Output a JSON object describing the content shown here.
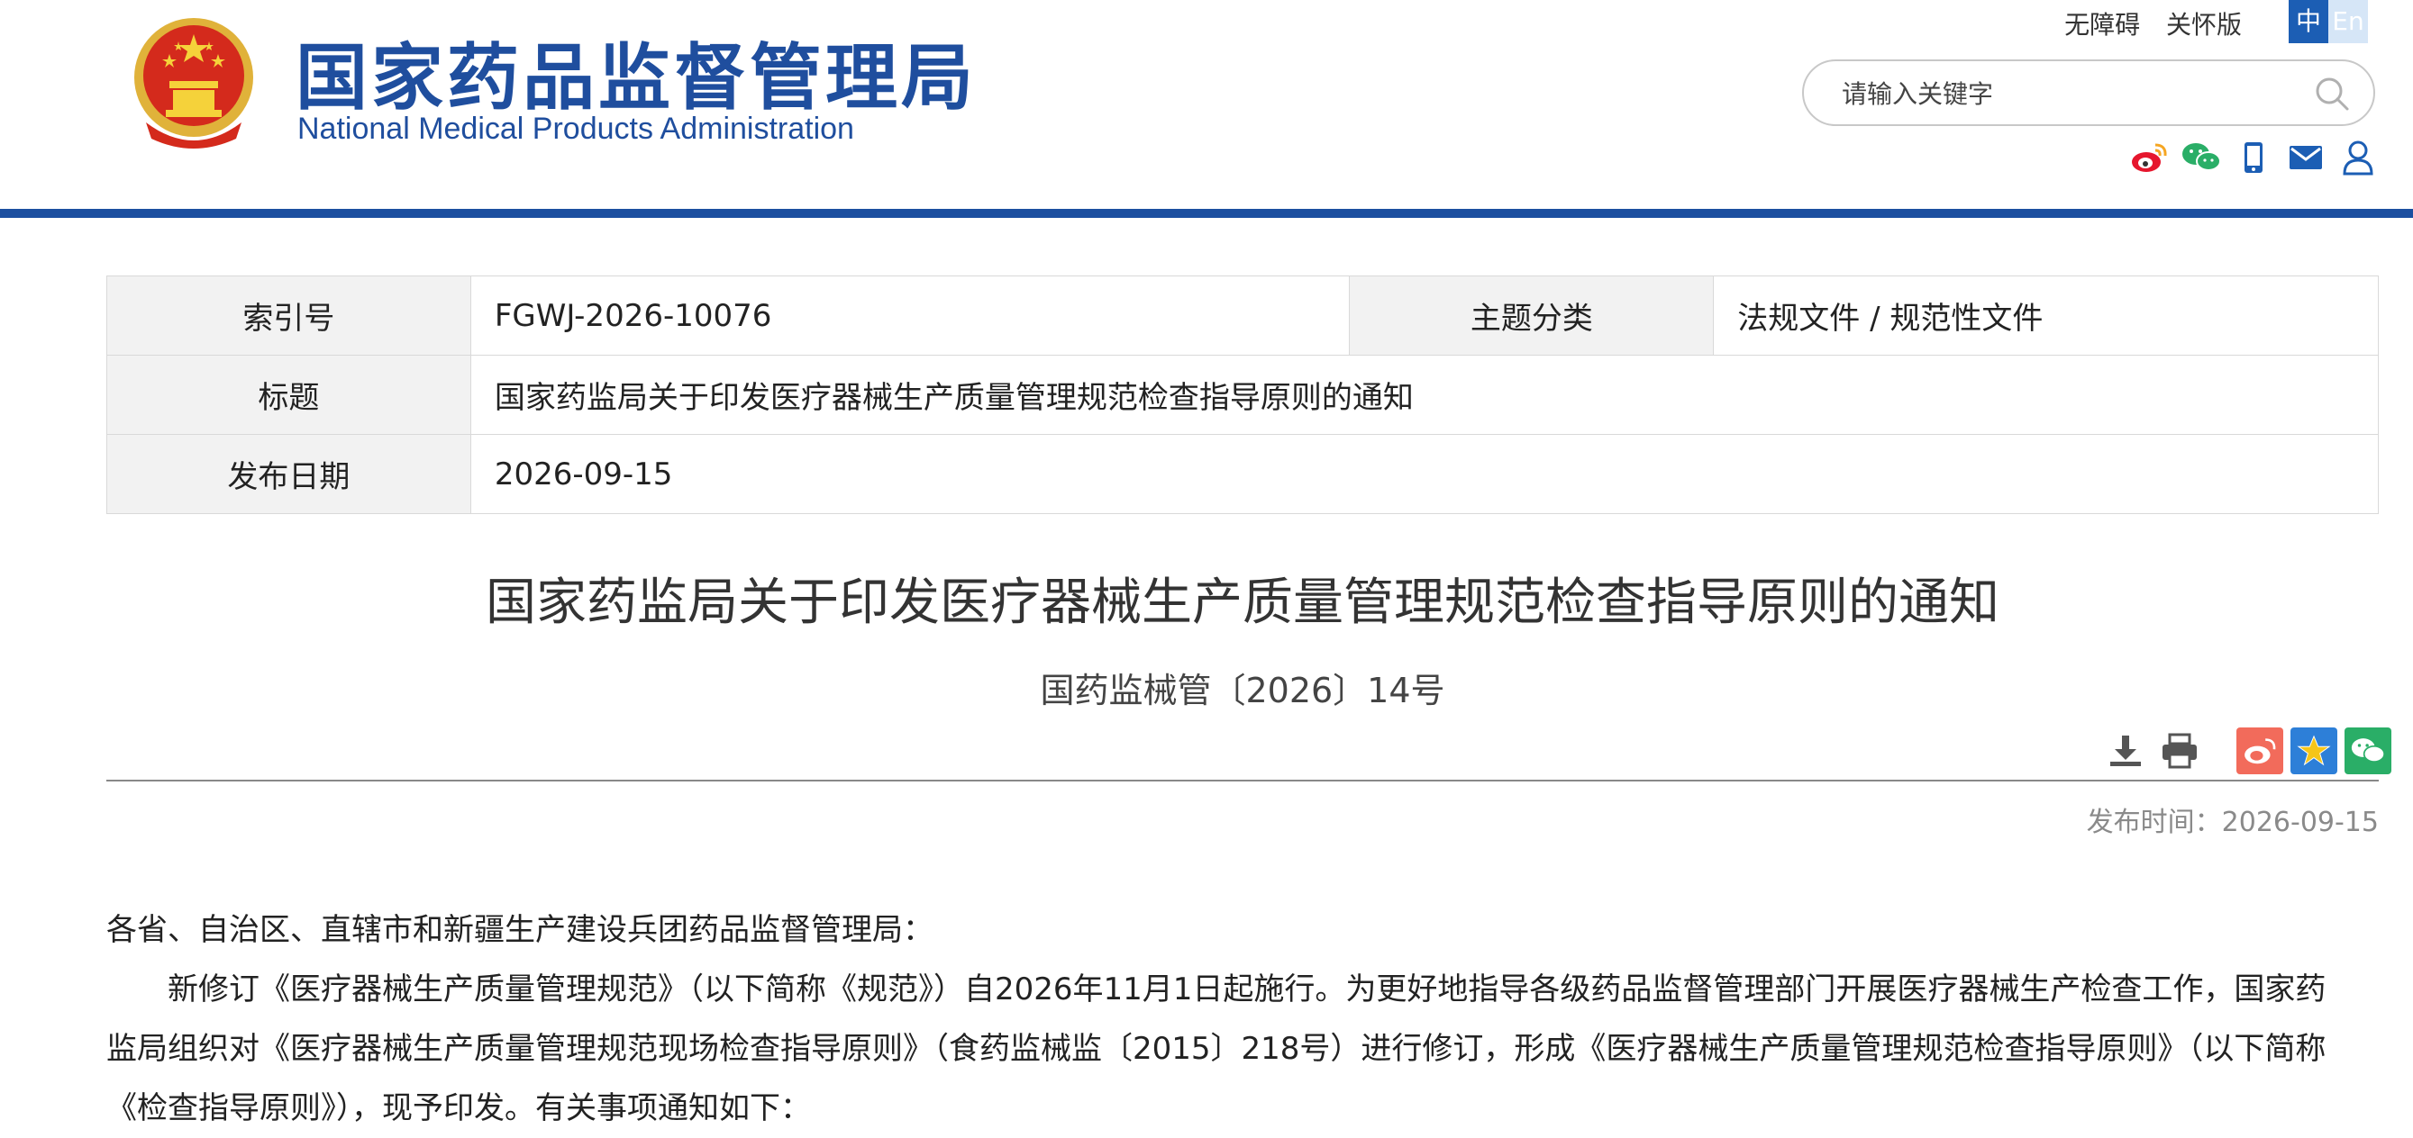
{
  "header": {
    "site_name_cn": "国家药品监督管理局",
    "site_name_en": "National Medical Products Administration",
    "accessibility_link": "无障碍",
    "care_mode_link": "关怀版",
    "lang_zh": "中",
    "lang_en": "En",
    "search_placeholder": "请输入关键字",
    "social_icons": [
      "weibo-icon",
      "wechat-icon",
      "mobile-icon",
      "mail-icon",
      "user-icon"
    ]
  },
  "info_table": {
    "index_label": "索引号",
    "index_value": "FGWJ-2026-10076",
    "category_label": "主题分类",
    "category_value": "法规文件 / 规范性文件",
    "title_label": "标题",
    "title_value": "国家药监局关于印发医疗器械生产质量管理规范检查指导原则的通知",
    "date_label": "发布日期",
    "date_value": "2026-09-15"
  },
  "article": {
    "title": "国家药监局关于印发医疗器械生产质量管理规范检查指导原则的通知",
    "doc_number": "国药监械管〔2026〕14号",
    "publish_time": "发布时间：2026-09-15",
    "salutation": "各省、自治区、直辖市和新疆生产建设兵团药品监督管理局：",
    "paragraph1": "新修订《医疗器械生产质量管理规范》（以下简称《规范》）自2026年11月1日起施行。为更好地指导各级药品监督管理部门开展医疗器械生产检查工作，国家药监局组织对《医疗器械生产质量管理规范现场检查指导原则》（食药监械监〔2015〕218号）进行修订，形成《医疗器械生产质量管理规范检查指导原则》（以下简称《检查指导原则》），现予印发。有关事项通知如下："
  },
  "colors": {
    "brand_blue": "#1f4e9e",
    "bar_blue": "#1c4fa0",
    "weibo_red": "#e6162d",
    "wechat_green": "#2aae67"
  }
}
